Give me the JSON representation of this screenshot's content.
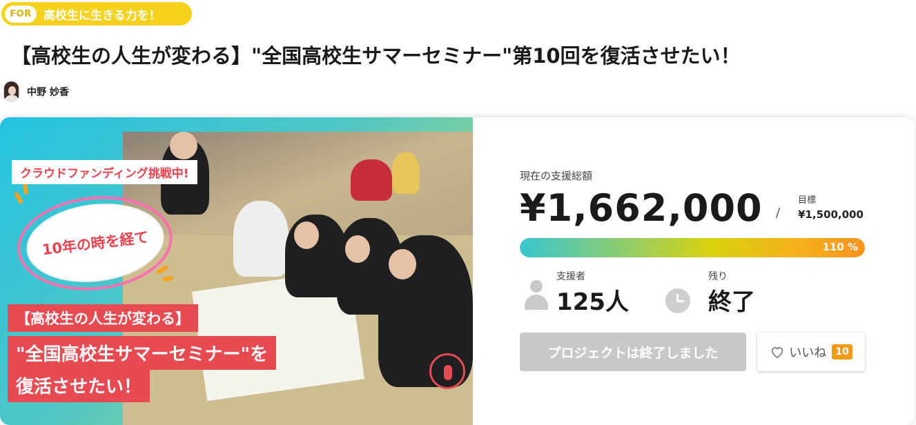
{
  "tag": {
    "prefix": "FOR",
    "text": "高校生に生きる力を！"
  },
  "title": "【高校生の人生が変わる】\"全国高校生サマーセミナー\"第10回を復活させたい！",
  "author": {
    "name": "中野 妙香"
  },
  "hero": {
    "badge": "クラウドファンディング挑戦中!",
    "bubble": "10年の時を経て",
    "line1": "【高校生の人生が変わる】",
    "line2": "\"全国高校生サマーセミナー\"を",
    "line3": "復活させたい！"
  },
  "funding": {
    "current_label": "現在の支援総額",
    "amount": "¥1,662,000",
    "slash": "/",
    "goal_label": "目標",
    "goal_value": "¥1,500,000",
    "progress_percent": 110,
    "progress_label": "110 %"
  },
  "stats": {
    "supporters_label": "支援者",
    "supporters_value": "125人",
    "remaining_label": "残り",
    "remaining_value": "終了"
  },
  "actions": {
    "ended_label": "プロジェクトは終了しました",
    "like_label": "いいね",
    "like_count": "10"
  },
  "colors": {
    "tag": "#f6d21c",
    "accent_red": "#e84a51",
    "like_badge": "#f59a16",
    "disabled_button": "#c8c8c8"
  },
  "icons": [
    "person-icon",
    "clock-icon",
    "heart-icon",
    "tap-icon"
  ]
}
